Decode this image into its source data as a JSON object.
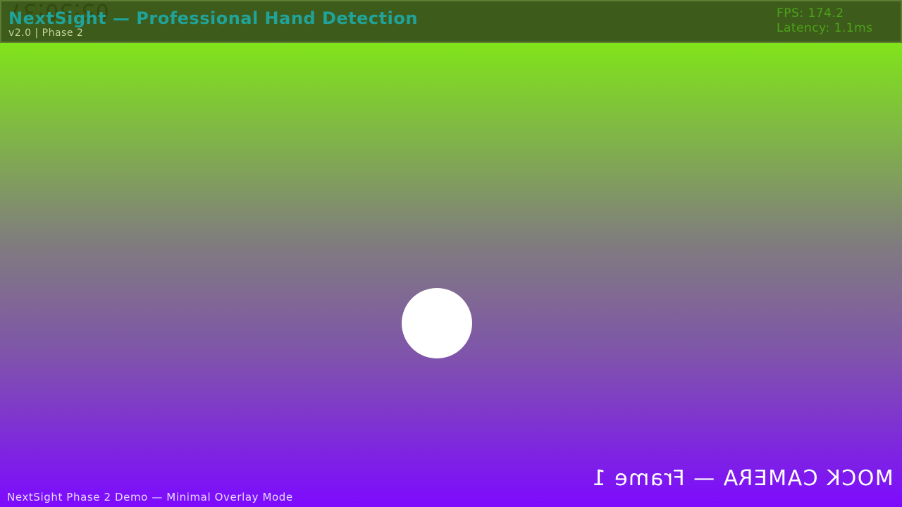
{
  "header": {
    "clock_mirrored": "05:50:37",
    "title": "NextSight — Professional Hand Detection",
    "version_line": "v2.0 | Phase 2",
    "stats": {
      "fps": "FPS: 174.2",
      "latency": "Latency: 1.1ms"
    }
  },
  "camera": {
    "frame_label_mirrored": "MOCK CAMERA — Frame 1"
  },
  "footer": {
    "status_text": "NextSight Phase 2 Demo — Minimal Overlay Mode"
  },
  "colors": {
    "header_background": "#3d5b1a",
    "title_color": "#1fa39a",
    "stats_color": "#4ea31a",
    "gradient_top": "#80ea14",
    "gradient_bottom": "#7e0aff",
    "marker_color": "#ffffff"
  }
}
